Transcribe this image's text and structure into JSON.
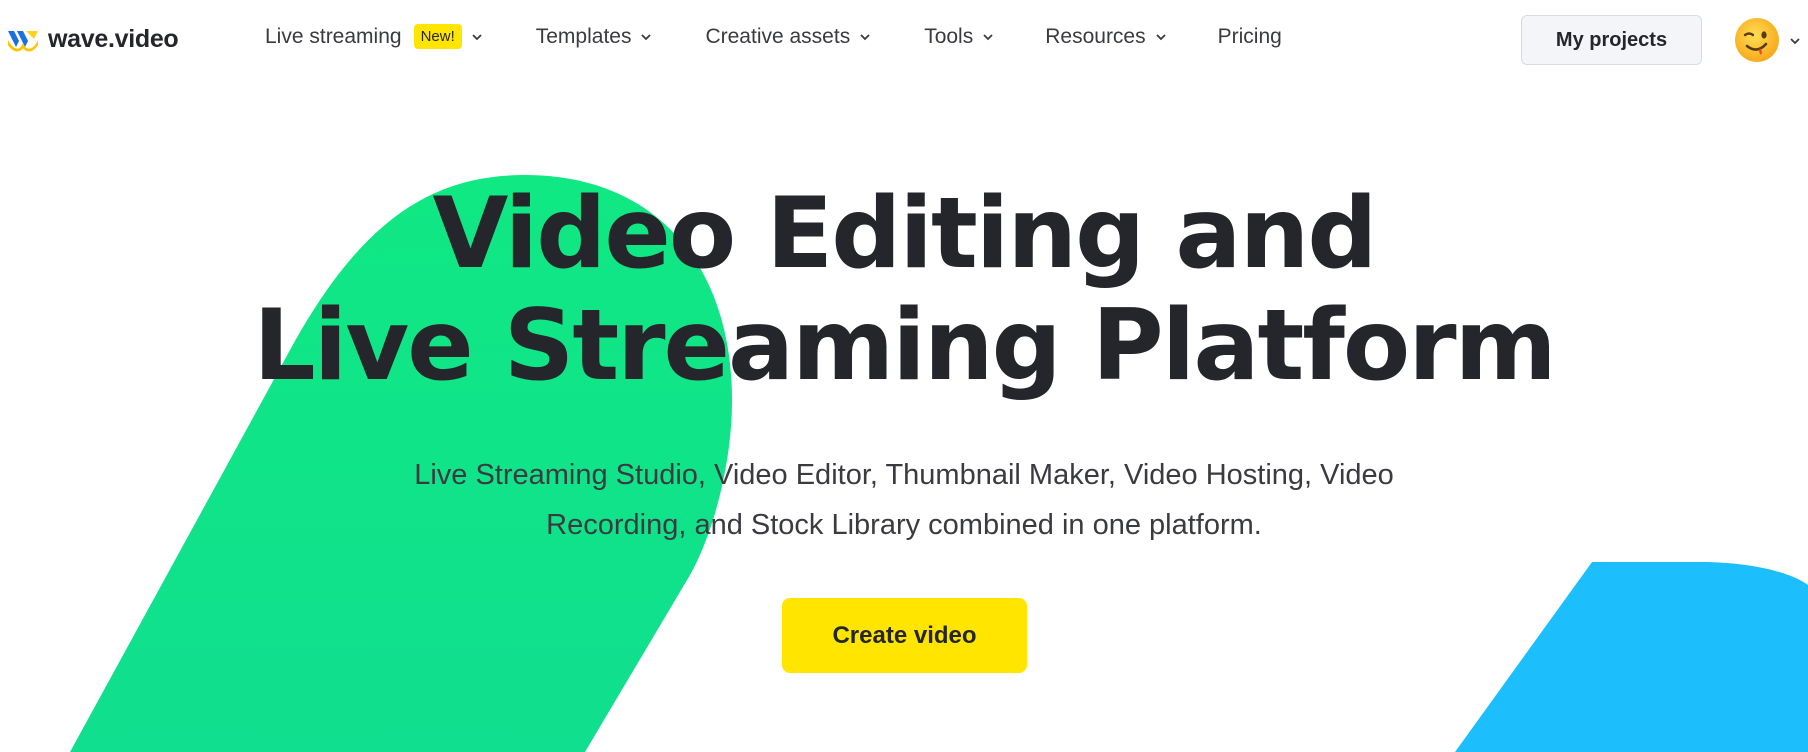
{
  "brand": {
    "name": "wave.video",
    "colors": {
      "green": "#10e883",
      "blue": "#1cbefc",
      "yellow": "#ffe500",
      "text": "#25262b"
    }
  },
  "nav": {
    "items": [
      {
        "label": "Live streaming",
        "badge": "New!",
        "has_dropdown": true
      },
      {
        "label": "Templates",
        "has_dropdown": true
      },
      {
        "label": "Creative assets",
        "has_dropdown": true
      },
      {
        "label": "Tools",
        "has_dropdown": true
      },
      {
        "label": "Resources",
        "has_dropdown": true
      },
      {
        "label": "Pricing",
        "has_dropdown": false
      }
    ]
  },
  "header": {
    "my_projects_label": "My projects",
    "avatar_icon": "winking-face-emoji"
  },
  "hero": {
    "title_line1": "Video Editing and",
    "title_line2": "Live Streaming Platform",
    "subtitle_line1": "Live Streaming Studio, Video Editor, Thumbnail Maker, Video Hosting, Video",
    "subtitle_line2": "Recording, and Stock Library combined in one platform.",
    "cta_label": "Create video"
  }
}
